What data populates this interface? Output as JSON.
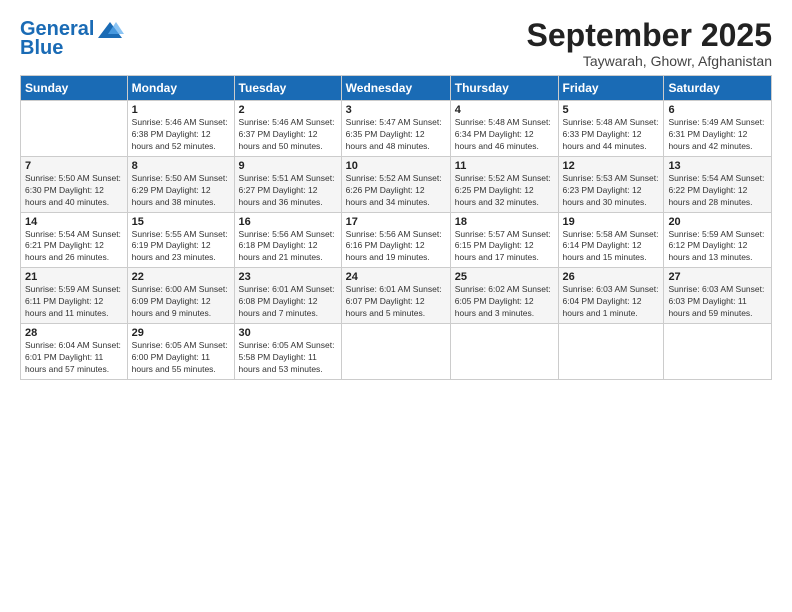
{
  "logo": {
    "general": "General",
    "blue": "Blue"
  },
  "title": "September 2025",
  "location": "Taywarah, Ghowr, Afghanistan",
  "headers": [
    "Sunday",
    "Monday",
    "Tuesday",
    "Wednesday",
    "Thursday",
    "Friday",
    "Saturday"
  ],
  "weeks": [
    [
      {
        "day": "",
        "info": ""
      },
      {
        "day": "1",
        "info": "Sunrise: 5:46 AM\nSunset: 6:38 PM\nDaylight: 12 hours\nand 52 minutes."
      },
      {
        "day": "2",
        "info": "Sunrise: 5:46 AM\nSunset: 6:37 PM\nDaylight: 12 hours\nand 50 minutes."
      },
      {
        "day": "3",
        "info": "Sunrise: 5:47 AM\nSunset: 6:35 PM\nDaylight: 12 hours\nand 48 minutes."
      },
      {
        "day": "4",
        "info": "Sunrise: 5:48 AM\nSunset: 6:34 PM\nDaylight: 12 hours\nand 46 minutes."
      },
      {
        "day": "5",
        "info": "Sunrise: 5:48 AM\nSunset: 6:33 PM\nDaylight: 12 hours\nand 44 minutes."
      },
      {
        "day": "6",
        "info": "Sunrise: 5:49 AM\nSunset: 6:31 PM\nDaylight: 12 hours\nand 42 minutes."
      }
    ],
    [
      {
        "day": "7",
        "info": "Sunrise: 5:50 AM\nSunset: 6:30 PM\nDaylight: 12 hours\nand 40 minutes."
      },
      {
        "day": "8",
        "info": "Sunrise: 5:50 AM\nSunset: 6:29 PM\nDaylight: 12 hours\nand 38 minutes."
      },
      {
        "day": "9",
        "info": "Sunrise: 5:51 AM\nSunset: 6:27 PM\nDaylight: 12 hours\nand 36 minutes."
      },
      {
        "day": "10",
        "info": "Sunrise: 5:52 AM\nSunset: 6:26 PM\nDaylight: 12 hours\nand 34 minutes."
      },
      {
        "day": "11",
        "info": "Sunrise: 5:52 AM\nSunset: 6:25 PM\nDaylight: 12 hours\nand 32 minutes."
      },
      {
        "day": "12",
        "info": "Sunrise: 5:53 AM\nSunset: 6:23 PM\nDaylight: 12 hours\nand 30 minutes."
      },
      {
        "day": "13",
        "info": "Sunrise: 5:54 AM\nSunset: 6:22 PM\nDaylight: 12 hours\nand 28 minutes."
      }
    ],
    [
      {
        "day": "14",
        "info": "Sunrise: 5:54 AM\nSunset: 6:21 PM\nDaylight: 12 hours\nand 26 minutes."
      },
      {
        "day": "15",
        "info": "Sunrise: 5:55 AM\nSunset: 6:19 PM\nDaylight: 12 hours\nand 23 minutes."
      },
      {
        "day": "16",
        "info": "Sunrise: 5:56 AM\nSunset: 6:18 PM\nDaylight: 12 hours\nand 21 minutes."
      },
      {
        "day": "17",
        "info": "Sunrise: 5:56 AM\nSunset: 6:16 PM\nDaylight: 12 hours\nand 19 minutes."
      },
      {
        "day": "18",
        "info": "Sunrise: 5:57 AM\nSunset: 6:15 PM\nDaylight: 12 hours\nand 17 minutes."
      },
      {
        "day": "19",
        "info": "Sunrise: 5:58 AM\nSunset: 6:14 PM\nDaylight: 12 hours\nand 15 minutes."
      },
      {
        "day": "20",
        "info": "Sunrise: 5:59 AM\nSunset: 6:12 PM\nDaylight: 12 hours\nand 13 minutes."
      }
    ],
    [
      {
        "day": "21",
        "info": "Sunrise: 5:59 AM\nSunset: 6:11 PM\nDaylight: 12 hours\nand 11 minutes."
      },
      {
        "day": "22",
        "info": "Sunrise: 6:00 AM\nSunset: 6:09 PM\nDaylight: 12 hours\nand 9 minutes."
      },
      {
        "day": "23",
        "info": "Sunrise: 6:01 AM\nSunset: 6:08 PM\nDaylight: 12 hours\nand 7 minutes."
      },
      {
        "day": "24",
        "info": "Sunrise: 6:01 AM\nSunset: 6:07 PM\nDaylight: 12 hours\nand 5 minutes."
      },
      {
        "day": "25",
        "info": "Sunrise: 6:02 AM\nSunset: 6:05 PM\nDaylight: 12 hours\nand 3 minutes."
      },
      {
        "day": "26",
        "info": "Sunrise: 6:03 AM\nSunset: 6:04 PM\nDaylight: 12 hours\nand 1 minute."
      },
      {
        "day": "27",
        "info": "Sunrise: 6:03 AM\nSunset: 6:03 PM\nDaylight: 11 hours\nand 59 minutes."
      }
    ],
    [
      {
        "day": "28",
        "info": "Sunrise: 6:04 AM\nSunset: 6:01 PM\nDaylight: 11 hours\nand 57 minutes."
      },
      {
        "day": "29",
        "info": "Sunrise: 6:05 AM\nSunset: 6:00 PM\nDaylight: 11 hours\nand 55 minutes."
      },
      {
        "day": "30",
        "info": "Sunrise: 6:05 AM\nSunset: 5:58 PM\nDaylight: 11 hours\nand 53 minutes."
      },
      {
        "day": "",
        "info": ""
      },
      {
        "day": "",
        "info": ""
      },
      {
        "day": "",
        "info": ""
      },
      {
        "day": "",
        "info": ""
      }
    ]
  ]
}
